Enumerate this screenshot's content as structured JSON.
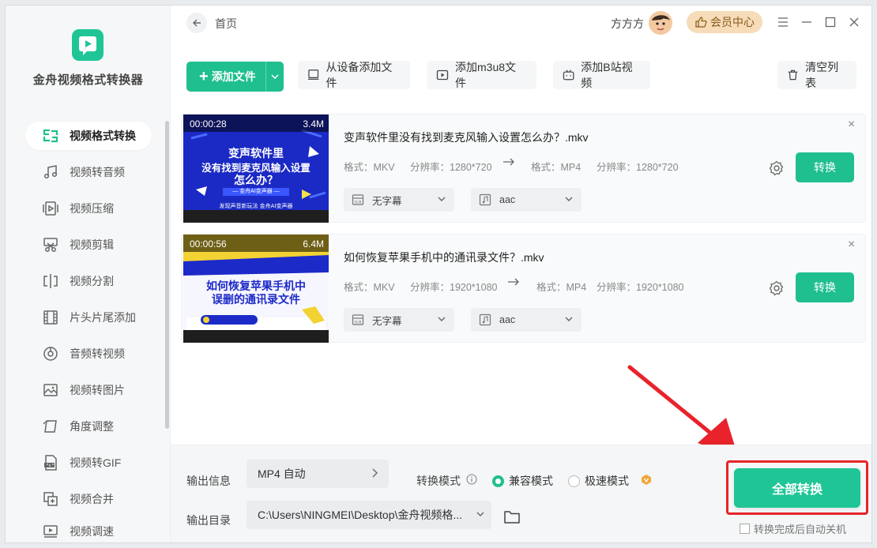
{
  "app": {
    "name": "金舟视频格式转换器"
  },
  "sidebar": {
    "items": [
      {
        "label": "视频格式转换",
        "icon": "convert-icon",
        "active": true
      },
      {
        "label": "视频转音频",
        "icon": "music-icon"
      },
      {
        "label": "视频压缩",
        "icon": "compress-icon"
      },
      {
        "label": "视频剪辑",
        "icon": "scissors-icon"
      },
      {
        "label": "视频分割",
        "icon": "split-icon"
      },
      {
        "label": "片头片尾添加",
        "icon": "film-icon"
      },
      {
        "label": "音频转视频",
        "icon": "disc-icon"
      },
      {
        "label": "视频转图片",
        "icon": "image-icon"
      },
      {
        "label": "角度调整",
        "icon": "rotate-icon"
      },
      {
        "label": "视频转GIF",
        "icon": "gif-icon"
      },
      {
        "label": "视频合并",
        "icon": "merge-icon"
      },
      {
        "label": "视频调速",
        "icon": "speed-icon"
      }
    ]
  },
  "header": {
    "breadcrumb": "首页",
    "username": "方方方",
    "vip_label": "会员中心"
  },
  "toolbar": {
    "add_file": "添加文件",
    "add_from_device": "从设备添加文件",
    "add_m3u8": "添加m3u8文件",
    "add_bilibili": "添加B站视频",
    "clear_list": "清空列表"
  },
  "files": [
    {
      "duration": "00:00:28",
      "size": "3.4M",
      "name": "变声软件里没有找到麦克风输入设置怎么办？.mkv",
      "src_format_label": "格式：MKV",
      "src_res_label": "分辨率：1280*720",
      "dst_format_label": "格式：MP4",
      "dst_res_label": "分辨率：1280*720",
      "subtitle": "无字幕",
      "audio": "aac",
      "convert": "转换",
      "thumb_lines": [
        "变声软件里",
        "没有找到麦克风输入设置",
        "怎么办？"
      ],
      "thumb_tag": "— 金舟AI变声器 —"
    },
    {
      "duration": "00:00:56",
      "size": "6.4M",
      "name": "如何恢复苹果手机中的通讯录文件？.mkv",
      "src_format_label": "格式：MKV",
      "src_res_label": "分辨率：1920*1080",
      "dst_format_label": "格式：MP4",
      "dst_res_label": "分辨率：1920*1080",
      "subtitle": "无字幕",
      "audio": "aac",
      "convert": "转换",
      "thumb_lines": [
        "如何恢复苹果手机中",
        "误删的通讯录文件"
      ],
      "thumb_tag": ""
    }
  ],
  "bottom": {
    "output_info_label": "输出信息",
    "output_format": "MP4 自动",
    "mode_label": "转换模式",
    "mode_compat": "兼容模式",
    "mode_fast": "极速模式",
    "output_dir_label": "输出目录",
    "output_dir": "C:\\Users\\NINGMEI\\Desktop\\金舟视频格...",
    "convert_all": "全部转换",
    "auto_shutdown": "转换完成后自动关机"
  },
  "colors": {
    "accent": "#1fc596",
    "highlight": "#e8232b",
    "vip": "#f6dcb8"
  }
}
